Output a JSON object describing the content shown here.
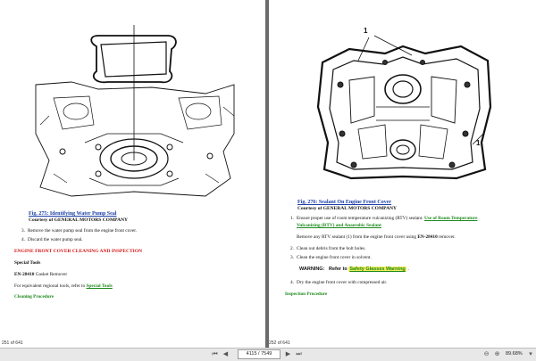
{
  "left_page": {
    "figure_caption": "Fig. 275: Identifying Water Pump Seal",
    "courtesy": "Courtesy of GENERAL MOTORS COMPANY",
    "steps": [
      {
        "num": "3.",
        "text": "Remove the water pump seal from the engine front cover."
      },
      {
        "num": "4.",
        "text": "Discard the water pump seal."
      }
    ],
    "section_heading": "ENGINE FRONT COVER CLEANING AND INSPECTION",
    "special_tools_heading": "Special Tools",
    "tool_code": "EN-28410",
    "tool_name": " Gasket Remover",
    "equivalent_text": "For equivalent regional tools, refer to ",
    "special_tools_link": "Special Tools",
    "procedure_heading": "Cleaning Procedure",
    "footer": "251 of 641"
  },
  "right_page": {
    "callouts": [
      "1",
      "1"
    ],
    "figure_caption": "Fig. 276: Sealant On Engine Front Cover",
    "courtesy": "Courtesy of GENERAL MOTORS COMPANY",
    "step1_num": "1.",
    "step1_text": "Ensure proper use of room temperature vulcanizing (RTV) sealant. ",
    "step1_link_a": "Use of Room Temperature",
    "step1_link_b": "Vulcanizing (RTV) and Anaerobic Sealant",
    "step1_sub_a": "Remove any RTV sealant (1) from the engine front cover using ",
    "step1_sub_tool": "EN-28410",
    "step1_sub_b": " remover.",
    "step2_num": "2.",
    "step2_text": "Clean out debris from the bolt holes.",
    "step3_num": "3.",
    "step3_text": "Clean the engine front cover in solvent.",
    "warning_label": "WARNING:",
    "warning_text": "Refer to ",
    "warning_link": "Safety Glasses Warning",
    "warning_end": " .",
    "step4_num": "4.",
    "step4_text": "Dry the engine front cover with compressed air.",
    "procedure_heading": "Inspection Procedure",
    "footer": "252 of 641"
  },
  "toolbar": {
    "page_value": "4115 / 7549",
    "zoom_value": "89.68%"
  }
}
